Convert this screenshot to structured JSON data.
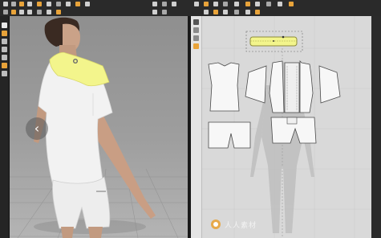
{
  "app": {
    "window_title": ""
  },
  "colors": {
    "dark_ui": "#2a2a2a",
    "viewport_3d_bg": "#9a9a9a",
    "viewport_2d_bg": "#d9d9d9",
    "selection_yellow": "#f3f58c",
    "accent_orange": "#e8a33a",
    "garment_white": "#f2f2f2"
  },
  "viewport_3d": {
    "nav_icon": "chevron-left-icon",
    "nav_label": "‹"
  },
  "viewport_2d": {
    "selected_piece": "collar"
  },
  "watermark": {
    "logo_icon": "watermark-logo-icon",
    "text": "人人素材"
  }
}
